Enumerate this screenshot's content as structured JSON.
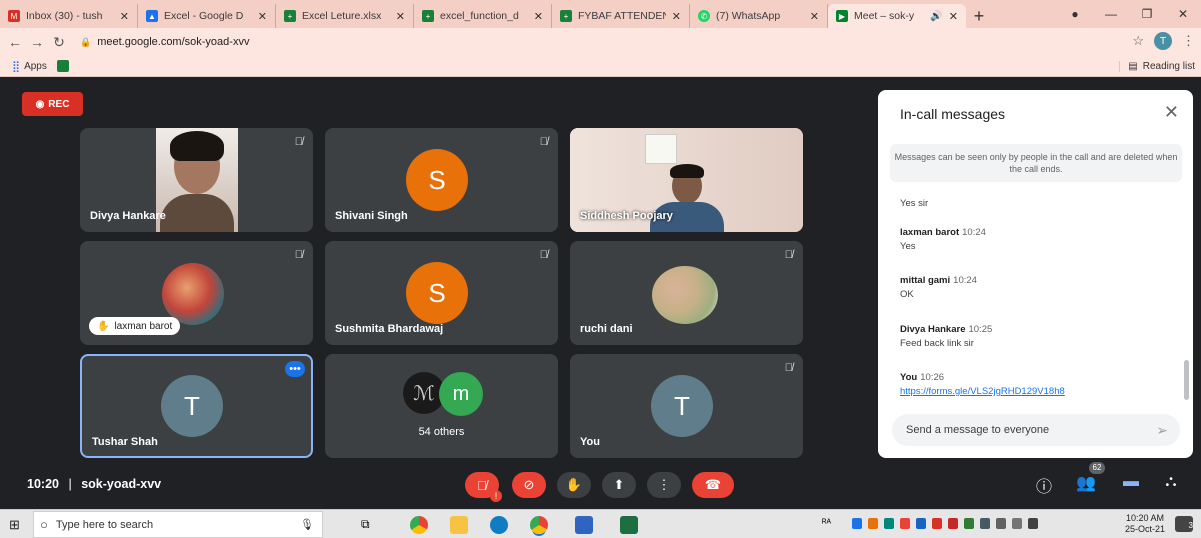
{
  "browser": {
    "tabs": [
      {
        "title": "Inbox (30) - tush",
        "icon": "gmail-icon",
        "color": "#d93025",
        "active": false
      },
      {
        "title": "Excel - Google D",
        "icon": "google-drive-icon",
        "color": "#1a73e8",
        "active": false
      },
      {
        "title": "Excel Leture.xlsx",
        "icon": "sheets-icon",
        "color": "#188038",
        "active": false
      },
      {
        "title": "excel_function_d",
        "icon": "sheets-icon",
        "color": "#188038",
        "active": false
      },
      {
        "title": "FYBAF ATTENDEN",
        "icon": "sheets-icon",
        "color": "#188038",
        "active": false
      },
      {
        "title": "(7) WhatsApp",
        "icon": "whatsapp-icon",
        "color": "#25d366",
        "active": false
      },
      {
        "title": "Meet – sok-y",
        "icon": "meet-icon",
        "color": "#00832d",
        "active": true
      }
    ],
    "url": "meet.google.com/sok-yoad-xvv",
    "bookmarks": {
      "apps_label": "Apps",
      "reading_list": "Reading list"
    },
    "profile_initial": "T"
  },
  "meet": {
    "rec_label": "REC",
    "meeting_time": "10:20",
    "meeting_code": "sok-yoad-xvv",
    "participant_count": "62",
    "tiles": [
      {
        "name": "Divya Hankare",
        "type": "video"
      },
      {
        "name": "Shivani Singh",
        "type": "avatar",
        "initial": "S",
        "color": "#e8710a"
      },
      {
        "name": "Siddhesh Poojary",
        "type": "video"
      },
      {
        "name": "laxman barot",
        "type": "image"
      },
      {
        "name": "Sushmita Bhardawaj",
        "type": "avatar",
        "initial": "S",
        "color": "#e8710a"
      },
      {
        "name": "ruchi dani",
        "type": "image"
      },
      {
        "name": "Tushar Shah",
        "type": "avatar",
        "initial": "T",
        "color": "#607d8b"
      },
      {
        "name": "54 others",
        "type": "group",
        "initials": [
          "m"
        ],
        "color": "#34a853"
      },
      {
        "name": "You",
        "type": "avatar",
        "initial": "T",
        "color": "#607d8b"
      }
    ]
  },
  "chat": {
    "title": "In-call messages",
    "notice": "Messages can be seen only by people in the call and are deleted when the call ends.",
    "messages": [
      {
        "sender": "",
        "time": "",
        "text": "Yes sir"
      },
      {
        "sender": "laxman barot",
        "time": "10:24",
        "text": "Yes"
      },
      {
        "sender": "mittal gami",
        "time": "10:24",
        "text": "OK"
      },
      {
        "sender": "Divya Hankare",
        "time": "10:25",
        "text": "Feed back link sir"
      },
      {
        "sender": "You",
        "time": "10:26",
        "text": "https://forms.gle/VLS2jgRHD129V18h8"
      }
    ],
    "placeholder": "Send a message to everyone"
  },
  "taskbar": {
    "search_placeholder": "Type here to search",
    "time": "10:20 AM",
    "date": "25-Oct-21",
    "notification_count": "3"
  }
}
